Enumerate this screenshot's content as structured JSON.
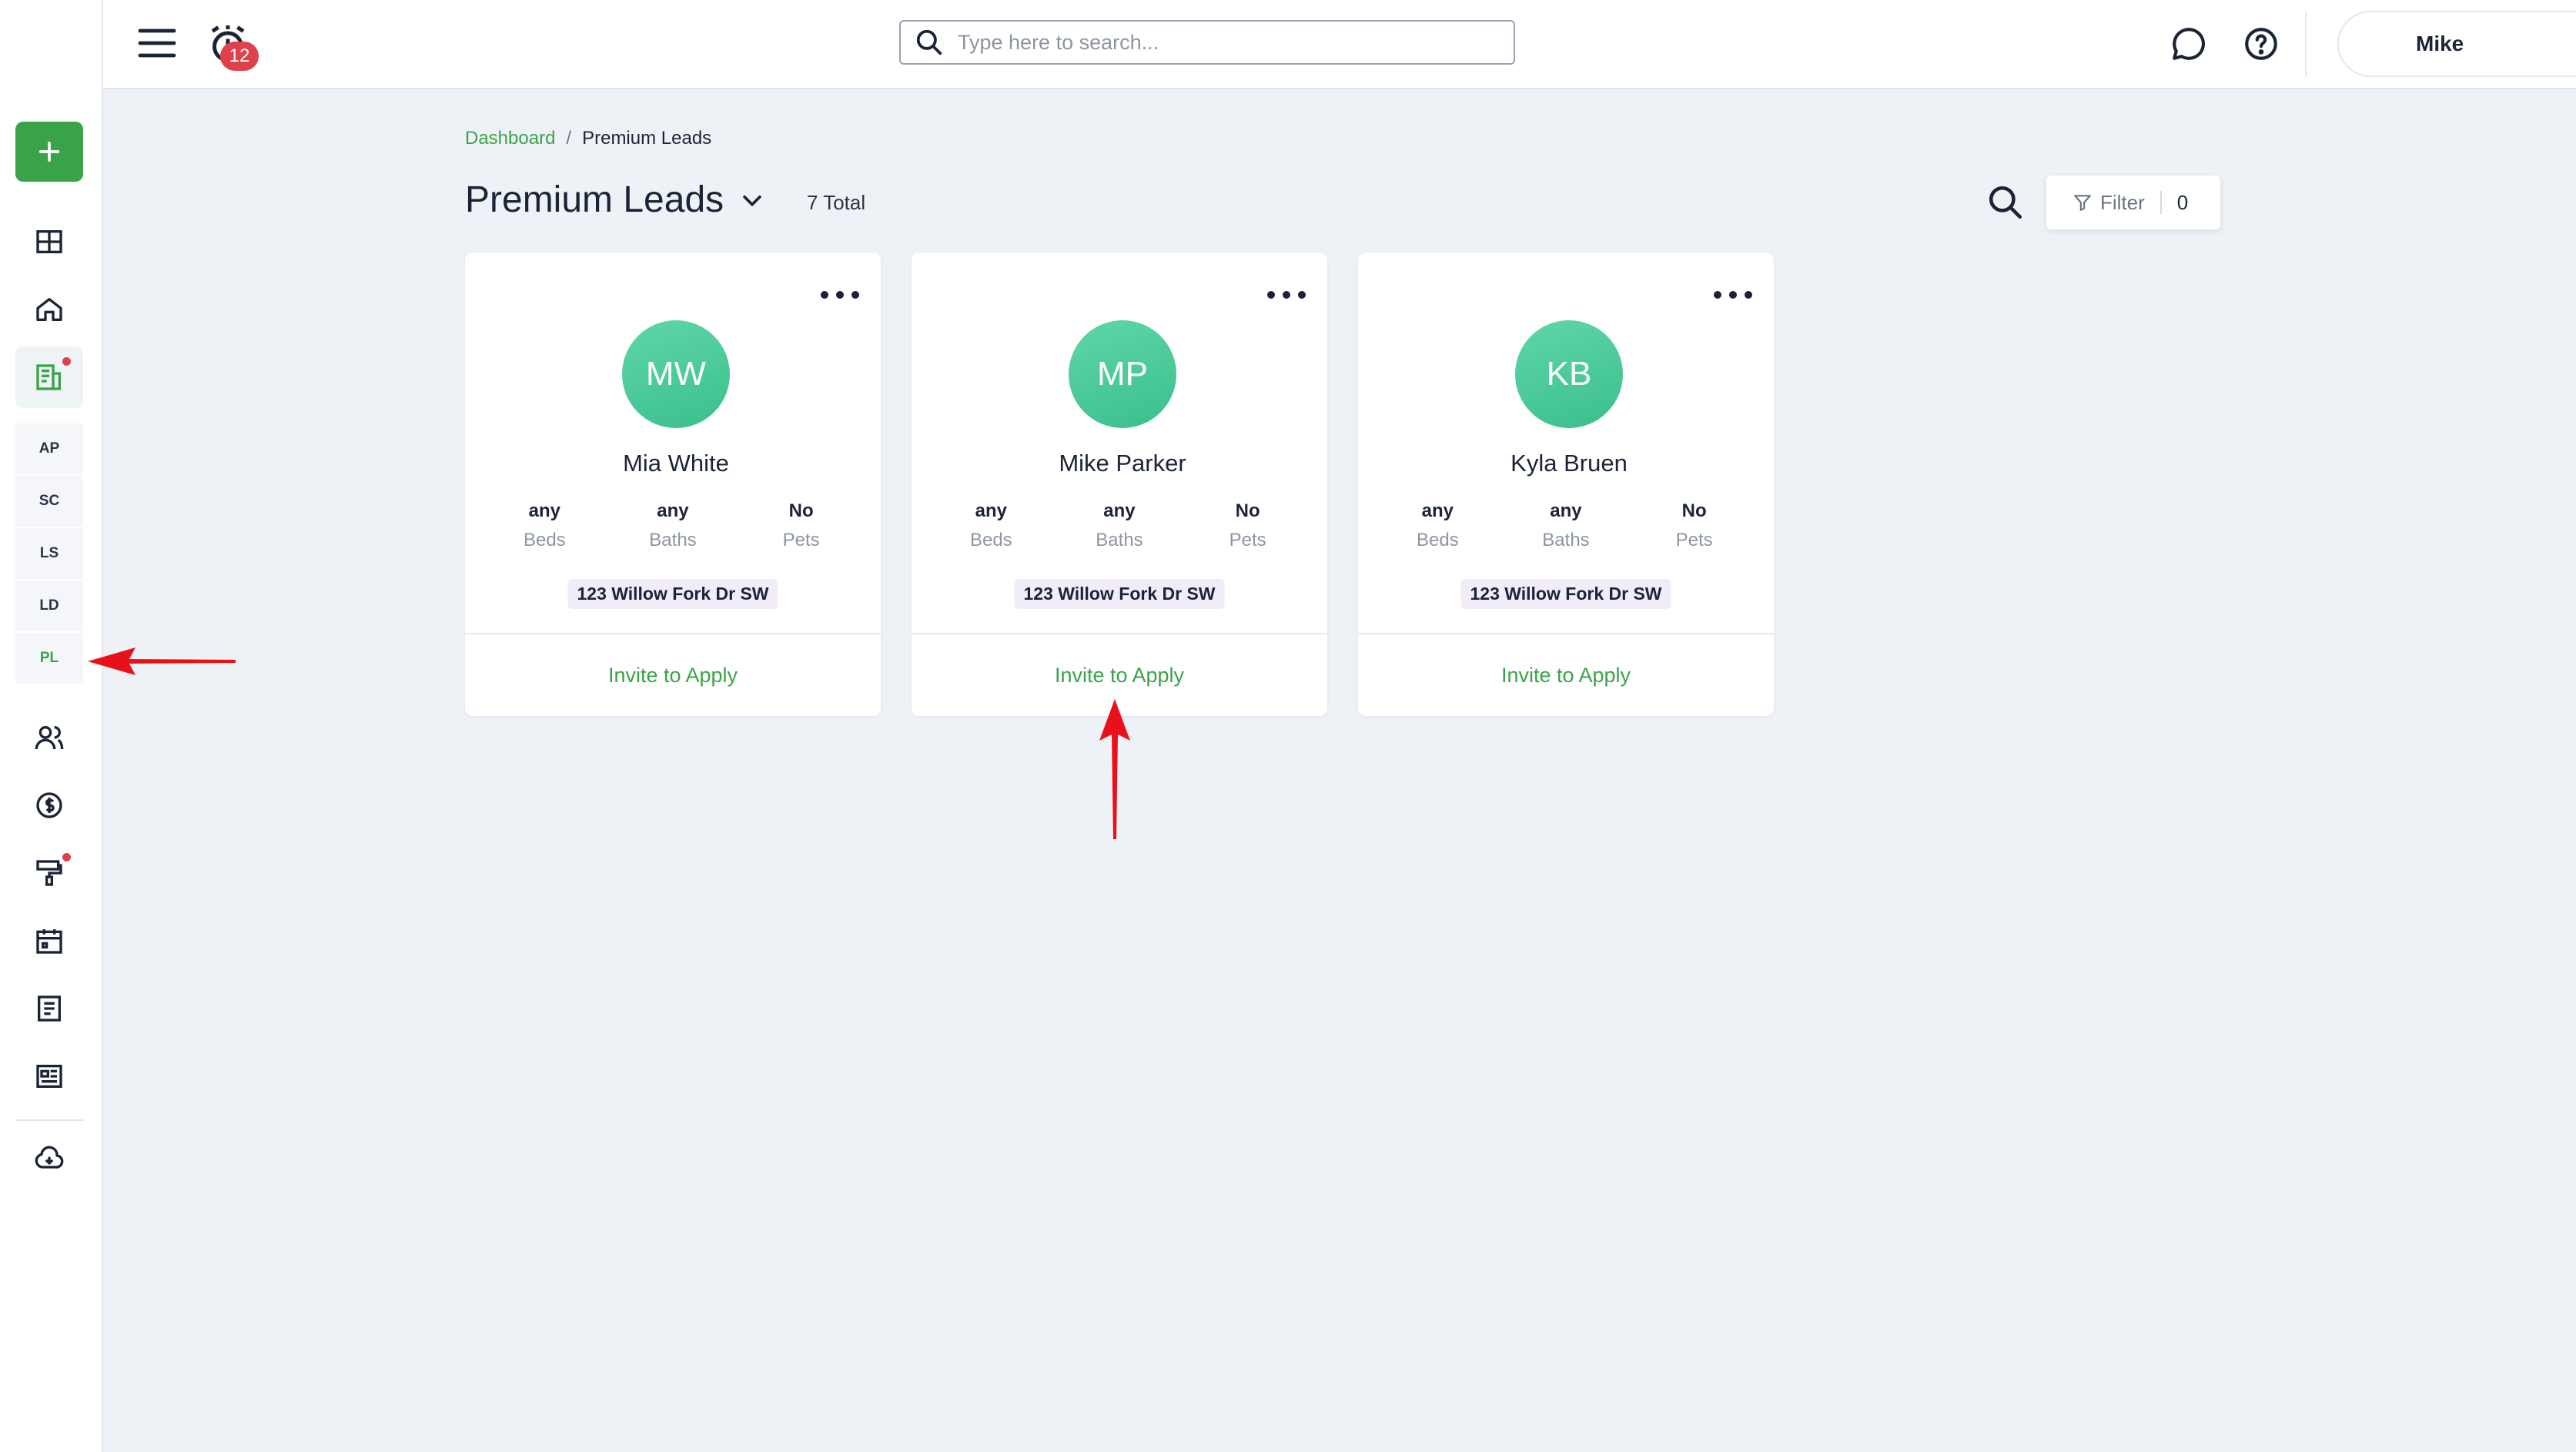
{
  "sidebar": {
    "add_button_icon": "plus-icon",
    "items": [
      {
        "icon": "dashboard-grid-icon"
      },
      {
        "icon": "home-icon"
      },
      {
        "icon": "leads-document-icon",
        "active": true,
        "dot": true
      }
    ],
    "sub_items": [
      {
        "label": "AP"
      },
      {
        "label": "SC"
      },
      {
        "label": "LS"
      },
      {
        "label": "LD"
      },
      {
        "label": "PL",
        "current": true
      }
    ],
    "lower_items": [
      {
        "icon": "users-icon"
      },
      {
        "icon": "dollar-circle-icon"
      },
      {
        "icon": "paint-roller-icon",
        "dot": true
      },
      {
        "icon": "calendar-icon"
      },
      {
        "icon": "report-icon"
      },
      {
        "icon": "listing-card-icon"
      }
    ],
    "bottom_icon": "cloud-download-icon"
  },
  "topbar": {
    "notification_count": "12",
    "search_placeholder": "Type here to search...",
    "user_name": "Mike"
  },
  "breadcrumb": {
    "link": "Dashboard",
    "separator": "/",
    "current": "Premium Leads"
  },
  "page": {
    "title": "Premium Leads",
    "total": "7 Total",
    "filter_label": "Filter",
    "filter_count": "0"
  },
  "cards": [
    {
      "initials": "MW",
      "name": "Mia White",
      "beds_value": "any",
      "beds_label": "Beds",
      "baths_value": "any",
      "baths_label": "Baths",
      "pets_value": "No",
      "pets_label": "Pets",
      "address": "123 Willow Fork Dr SW",
      "action": "Invite to Apply"
    },
    {
      "initials": "MP",
      "name": "Mike Parker",
      "beds_value": "any",
      "beds_label": "Beds",
      "baths_value": "any",
      "baths_label": "Baths",
      "pets_value": "No",
      "pets_label": "Pets",
      "address": "123 Willow Fork Dr SW",
      "action": "Invite to Apply"
    },
    {
      "initials": "KB",
      "name": "Kyla Bruen",
      "beds_value": "any",
      "beds_label": "Beds",
      "baths_value": "any",
      "baths_label": "Baths",
      "pets_value": "No",
      "pets_label": "Pets",
      "address": "123 Willow Fork Dr SW",
      "action": "Invite to Apply"
    }
  ],
  "colors": {
    "accent": "#3aa348",
    "avatar": "#4fcb9a",
    "badge": "#e0404a",
    "annotation": "#e8111a"
  }
}
